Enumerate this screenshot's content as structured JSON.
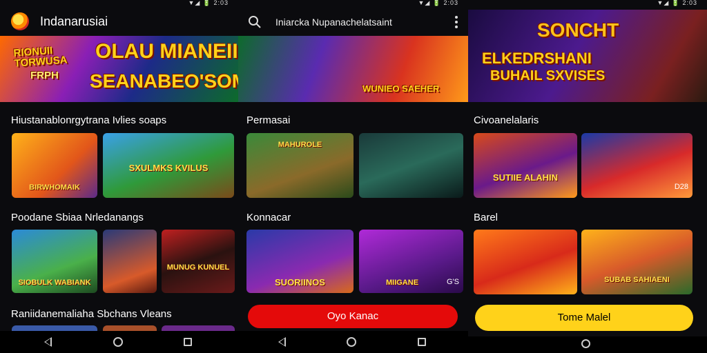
{
  "status": {
    "p1": "▼◢ 🔋 2:03",
    "p2": "▼◢ 🔋 2:03",
    "p3": "▼◢ 🔋 2:03"
  },
  "left": {
    "app_title": "Indanarusiai",
    "banner": {
      "line1": "RIONUII TORWUSA",
      "line2": "FRPH",
      "line3": "OLAU MIANEIIANIIIA",
      "line4": "SEANABEO'SOMATE!"
    },
    "section1": {
      "title": "Hiustanablonrgytrana Ivlies soaps",
      "tiles": [
        {
          "label": "BIRWHOMAIK"
        },
        {
          "label": "SXULMKS KVILUS"
        }
      ]
    },
    "section2": {
      "title": "Poodane Sbiaa Nrledanangs",
      "tiles": [
        {
          "label": "SIOBULK WABIANK"
        },
        {
          "label": ""
        },
        {
          "label": "MUNUG KUNUEL"
        }
      ]
    },
    "section3": {
      "title": "Raniidanemaliaha Sbchans Vleans"
    }
  },
  "middle": {
    "search_title": "Iniarcka Nupanachelatsaint",
    "banner": {
      "label": "WUNIEO SAEHER"
    },
    "section1": {
      "title": "Permasai",
      "tiles": [
        {
          "label": "MAHUROLE"
        },
        {
          "label": ""
        }
      ]
    },
    "section2": {
      "title": "Konnacar",
      "tiles": [
        {
          "label": "SUORIINOS"
        },
        {
          "label": "MIIGANE",
          "sub": "G'S"
        }
      ]
    },
    "cta": "Oyo Kanac"
  },
  "right": {
    "banner": {
      "line1": "SONCHT",
      "line2": "ELKEDRSHANI",
      "line3": "BUHAIL SXVISES"
    },
    "section1": {
      "title": "Civoanelalaris",
      "tiles": [
        {
          "label": "SUTIIE ALAHIN"
        },
        {
          "label": "",
          "sub": "D28"
        }
      ]
    },
    "section2": {
      "title": "Barel",
      "tiles": [
        {
          "label": ""
        },
        {
          "label": "SUBAB SAHIAENI"
        }
      ]
    },
    "cta": "Tome Malel"
  },
  "colors": {
    "accent_red": "#e40a0a",
    "accent_yellow": "#ffd21a",
    "background": "#0b0b0e"
  }
}
